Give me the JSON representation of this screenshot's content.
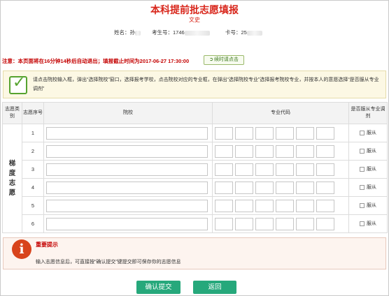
{
  "header": {
    "title": "本科提前批志愿填报",
    "subtitle": "文史"
  },
  "student": {
    "name_label": "姓名：",
    "name_value": "孙",
    "exam_no_label": "考生号：",
    "exam_no_value": "1746",
    "card_no_label": "卡号：",
    "card_no_value": "25"
  },
  "notice": {
    "text": "注意：本页面将在16分钟14秒后自动退出；填报截止时间为2017-06-27 17:30:00",
    "refresh_label": "续时请点击"
  },
  "tip": {
    "text": "请点击院校输入框，弹出“选择院校”窗口，选择报考学校，点击院校对应的专业框，在弹出“选择院校专业”选择报考院校专业，并按本人的意愿选择“是否服从专业调剂”"
  },
  "table": {
    "headers": {
      "category": "志愿类别",
      "seq": "志愿序号",
      "school": "院校",
      "major_code": "专业代码",
      "adjust": "是否服从专业调剂"
    },
    "category_label": "梯度志愿",
    "rows": [
      {
        "seq": "1",
        "adjust_label": "服从"
      },
      {
        "seq": "2",
        "adjust_label": "服从"
      },
      {
        "seq": "3",
        "adjust_label": "服从"
      },
      {
        "seq": "4",
        "adjust_label": "服从"
      },
      {
        "seq": "5",
        "adjust_label": "服从"
      },
      {
        "seq": "6",
        "adjust_label": "服从"
      }
    ]
  },
  "important": {
    "icon_glyph": "i",
    "title": "重要提示",
    "text": "输入志愿信息后，可直接按“确认提交”键提交即可保存你的志愿信息"
  },
  "actions": {
    "confirm_label": "确认提交",
    "back_label": "返回"
  },
  "colors": {
    "title_red": "#d8261b",
    "button_green": "#26a87b",
    "notice_red": "#c40000"
  }
}
